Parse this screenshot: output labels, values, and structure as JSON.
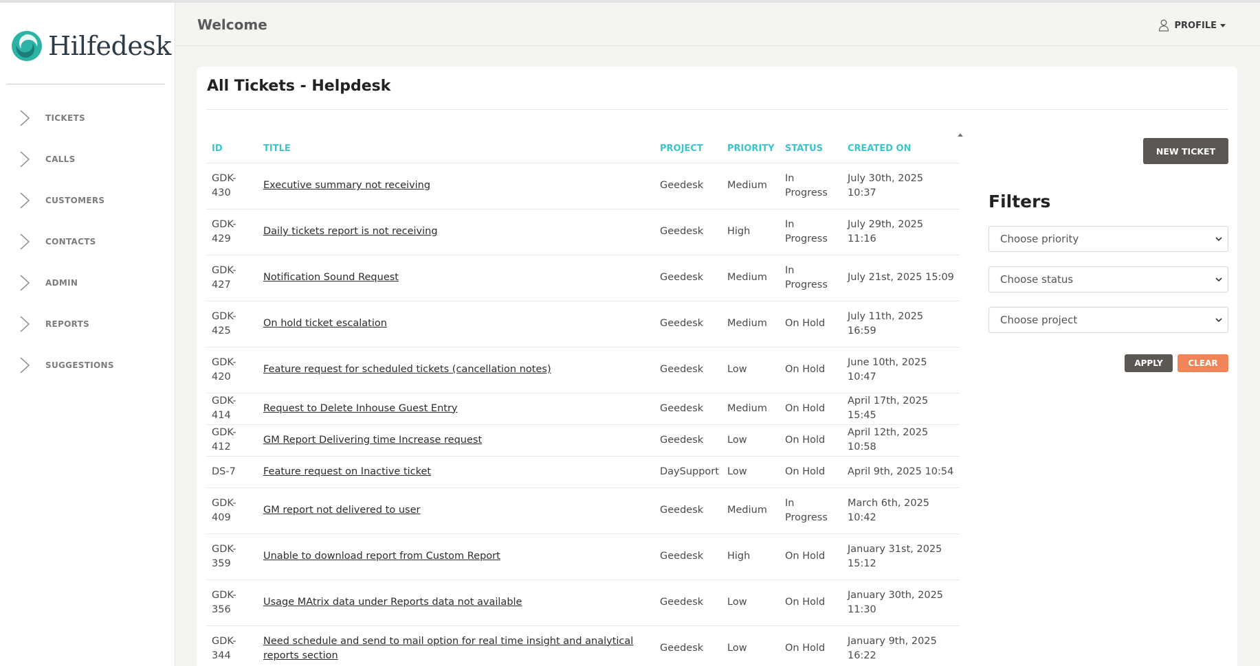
{
  "app": {
    "brand": "Hilfedesk"
  },
  "sidebar": {
    "items": [
      {
        "label": "TICKETS",
        "icon": "chevron-right-icon"
      },
      {
        "label": "CALLS",
        "icon": "chevron-right-icon"
      },
      {
        "label": "CUSTOMERS",
        "icon": "chevron-right-icon"
      },
      {
        "label": "CONTACTS",
        "icon": "chevron-right-icon"
      },
      {
        "label": "ADMIN",
        "icon": "chevron-right-icon"
      },
      {
        "label": "REPORTS",
        "icon": "chevron-right-icon"
      },
      {
        "label": "SUGGESTIONS",
        "icon": "chevron-right-icon"
      }
    ]
  },
  "header": {
    "welcome": "Welcome",
    "profile_label": "PROFILE",
    "profile_icon": "user-icon"
  },
  "main": {
    "title": "All Tickets - Helpdesk",
    "columns": [
      "ID",
      "TITLE",
      "PROJECT",
      "PRIORITY",
      "STATUS",
      "CREATED ON"
    ],
    "rows": [
      {
        "id": "GDK-\n430",
        "title": "Executive summary not receiving",
        "project": "Geedesk",
        "priority": "Medium",
        "status": "In\nProgress",
        "created": "July 30th, 2025 10:37"
      },
      {
        "id": "GDK-\n429",
        "title": "Daily tickets report is not receiving",
        "project": "Geedesk",
        "priority": "High",
        "status": "In\nProgress",
        "created": "July 29th, 2025 11:16"
      },
      {
        "id": "GDK-\n427",
        "title": "Notification Sound Request",
        "project": "Geedesk",
        "priority": "Medium",
        "status": "In\nProgress",
        "created": "July 21st, 2025 15:09"
      },
      {
        "id": "GDK-\n425",
        "title": "On hold ticket escalation",
        "project": "Geedesk",
        "priority": "Medium",
        "status": "On Hold",
        "created": "July 11th, 2025 16:59"
      },
      {
        "id": "GDK-\n420",
        "title": "Feature request for scheduled tickets (cancellation notes)",
        "project": "Geedesk",
        "priority": "Low",
        "status": "On Hold",
        "created": "June 10th, 2025 10:47"
      },
      {
        "id": "GDK-414",
        "title": "Request to Delete Inhouse Guest Entry",
        "project": "Geedesk",
        "priority": "Medium",
        "status": "On Hold",
        "created": "April 17th, 2025 15:45"
      },
      {
        "id": "GDK-412",
        "title": "GM Report Delivering time Increase request",
        "project": "Geedesk",
        "priority": "Low",
        "status": "On Hold",
        "created": "April 12th, 2025 10:58"
      },
      {
        "id": "DS-7",
        "title": "Feature request on Inactive ticket",
        "project": "DaySupport",
        "priority": "Low",
        "status": "On Hold",
        "created": "April 9th, 2025 10:54"
      },
      {
        "id": "GDK-\n409",
        "title": "GM report not delivered to user",
        "project": "Geedesk",
        "priority": "Medium",
        "status": "In\nProgress",
        "created": "March 6th, 2025 10:42"
      },
      {
        "id": "GDK-\n359",
        "title": "Unable to download report from Custom Report",
        "project": "Geedesk",
        "priority": "High",
        "status": "On Hold",
        "created": "January 31st, 2025\n15:12"
      },
      {
        "id": "GDK-\n356",
        "title": "Usage MAtrix data under Reports data not available",
        "project": "Geedesk",
        "priority": "Low",
        "status": "On Hold",
        "created": "January 30th, 2025\n11:30"
      },
      {
        "id": "GDK-\n344",
        "title": "Need schedule and send to mail option for real time insight and analytical\nreports section",
        "project": "Geedesk",
        "priority": "Low",
        "status": "On Hold",
        "created": "January 9th, 2025\n16:22"
      }
    ]
  },
  "actions": {
    "new_ticket": "NEW TICKET",
    "apply": "APPLY",
    "clear": "CLEAR"
  },
  "filters": {
    "title": "Filters",
    "priority_placeholder": "Choose priority",
    "status_placeholder": "Choose status",
    "project_placeholder": "Choose project"
  },
  "colors": {
    "accent": "#3cc4cc",
    "dark_button": "#5b5752",
    "clear_button": "#f08457"
  }
}
